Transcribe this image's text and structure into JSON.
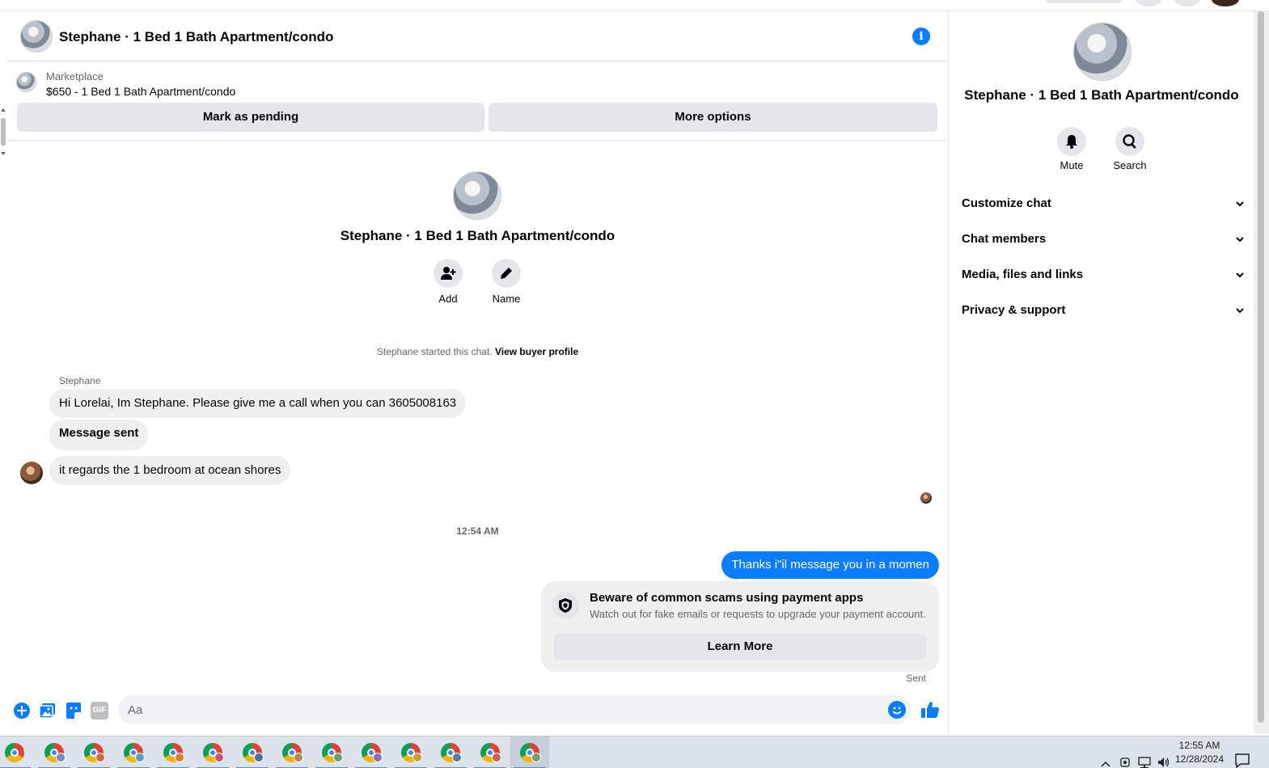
{
  "chat": {
    "title": "Stephane · 1 Bed 1 Bath Apartment/condo",
    "marketplace": {
      "label": "Marketplace",
      "listing": "$650 - 1 Bed 1 Bath Apartment/condo",
      "mark_pending": "Mark as pending",
      "more_options": "More options"
    },
    "intro": {
      "name": "Stephane · 1 Bed 1 Bath Apartment/condo",
      "add_label": "Add",
      "name_label": "Name"
    },
    "system": {
      "started": "Stephane started this chat.",
      "view_profile": "View buyer profile"
    },
    "messages": {
      "sender": "Stephane",
      "incoming": [
        "Hi Lorelai, Im Stephane. Please give me a call when you can 3605008163",
        "Message sent",
        "it regards the 1 bedroom at ocean shores"
      ],
      "timestamp": "12:54 AM",
      "outgoing": "Thanks i\"il message you in a momen",
      "scam_notice": {
        "title": "Beware of common scams using payment apps",
        "description": "Watch out for fake emails or requests to upgrade your payment account.",
        "button": "Learn More"
      },
      "status": "Sent"
    },
    "composer": {
      "placeholder": "Aa",
      "gif_label": "GIF"
    }
  },
  "info_panel": {
    "name": "Stephane · 1 Bed 1 Bath Apartment/condo",
    "actions": {
      "mute": "Mute",
      "search": "Search"
    },
    "sections": [
      "Customize chat",
      "Chat members",
      "Media, files and links",
      "Privacy & support"
    ]
  },
  "taskbar": {
    "time": "12:55 AM",
    "date": "12/28/2024"
  },
  "colors": {
    "accent": "#0a7cff",
    "bubble_in": "#f0f0f0",
    "button_grey": "#e4e6eb",
    "muted_text": "#65676b"
  }
}
